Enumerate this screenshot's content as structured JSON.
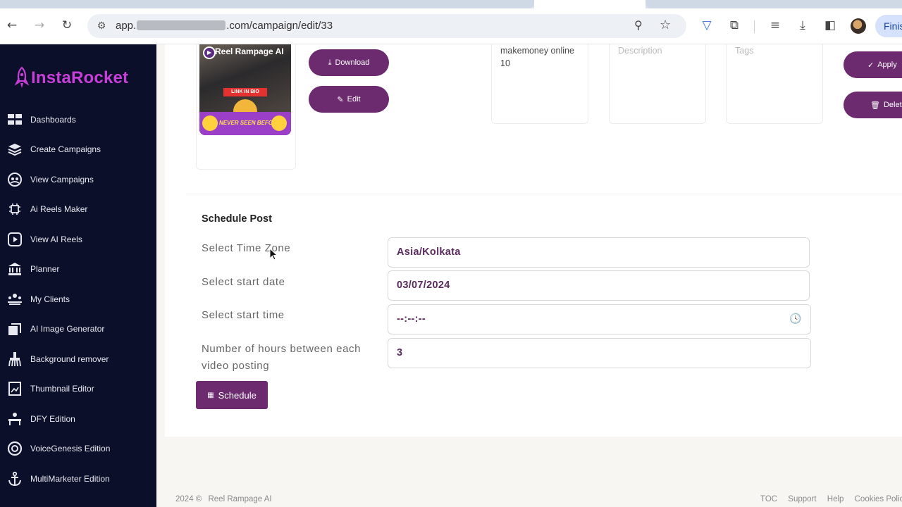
{
  "browser": {
    "url_prefix": "app.",
    "url_suffix": ".com/campaign/edit/33",
    "profile_button": "Finis"
  },
  "sidebar": {
    "brand": "InstaRocket",
    "items": [
      {
        "label": "Dashboards",
        "icon": "grid-icon"
      },
      {
        "label": "Create Campaigns",
        "icon": "layers-icon"
      },
      {
        "label": "View Campaigns",
        "icon": "users-circle-icon"
      },
      {
        "label": "Ai Reels Maker",
        "icon": "ai-chip-icon"
      },
      {
        "label": "View AI Reels",
        "icon": "play-square-icon"
      },
      {
        "label": "Planner",
        "icon": "bank-icon"
      },
      {
        "label": "My Clients",
        "icon": "clients-icon"
      },
      {
        "label": "AI Image Generator",
        "icon": "images-icon"
      },
      {
        "label": "Background remover",
        "icon": "brush-icon"
      },
      {
        "label": "Thumbnail Editor",
        "icon": "thumbnail-icon"
      },
      {
        "label": "DFY Edition",
        "icon": "desk-icon"
      },
      {
        "label": "VoiceGenesis Edition",
        "icon": "voice-icon"
      },
      {
        "label": "MultiMarketer Edition",
        "icon": "anchor-icon"
      }
    ]
  },
  "reel": {
    "thumb_title": "Reel Rampage AI",
    "thumb_link_text": "LINK IN BIO",
    "thumb_banner": "NEVER SEEN BEFORE",
    "download_label": "Download",
    "edit_label": "Edit",
    "caption": "makemoney online 10",
    "description_placeholder": "Description",
    "tags_placeholder": "Tags",
    "apply_label": "Apply",
    "delete_label": "Delet"
  },
  "schedule": {
    "title": "Schedule Post",
    "timezone_label": "Select Time Zone",
    "timezone_value": "Asia/Kolkata",
    "start_date_label": "Select start date",
    "start_date_value": "03/07/2024",
    "start_time_label": "Select start time",
    "start_time_value": "--:--:--",
    "hours_label": "Number of hours between each video posting",
    "hours_value": "3",
    "button_label": "Schedule"
  },
  "footer": {
    "copyright": "2024 ©",
    "brand": "Reel Rampage AI",
    "links": [
      "TOC",
      "Support",
      "Help",
      "Cookies Polic"
    ]
  },
  "colors": {
    "sidebar_bg": "#0b0f2a",
    "brand": "#c83fd8",
    "accent": "#6b2b6e"
  }
}
